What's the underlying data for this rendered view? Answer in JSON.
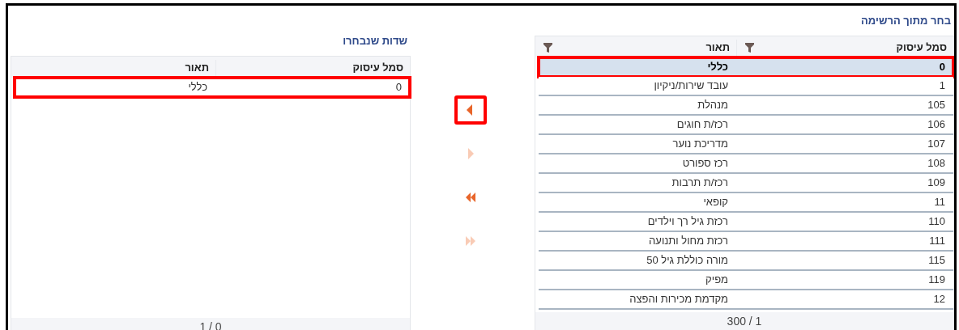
{
  "available": {
    "title": "בחר מתוך הרשימה",
    "columns": [
      {
        "label": "סמל עיסוק",
        "filter": true
      },
      {
        "label": "תאור",
        "filter": true
      }
    ],
    "rows": [
      {
        "code": "0",
        "description": "כללי",
        "selected": true,
        "highlighted": true
      },
      {
        "code": "1",
        "description": "עובד שירות/ניקיון",
        "selected": false,
        "highlighted": false
      },
      {
        "code": "105",
        "description": "מנהלת",
        "selected": false,
        "highlighted": false
      },
      {
        "code": "106",
        "description": "רכז/ת חוגים",
        "selected": false,
        "highlighted": false
      },
      {
        "code": "107",
        "description": "מדריכת נוער",
        "selected": false,
        "highlighted": false
      },
      {
        "code": "108",
        "description": "רכז ספורט",
        "selected": false,
        "highlighted": false
      },
      {
        "code": "109",
        "description": "רכז/ת תרבות",
        "selected": false,
        "highlighted": false
      },
      {
        "code": "11",
        "description": "קופאי",
        "selected": false,
        "highlighted": false
      },
      {
        "code": "110",
        "description": "רכזת גיל רך וילדים",
        "selected": false,
        "highlighted": false
      },
      {
        "code": "111",
        "description": "רכזת מחול ותנועה",
        "selected": false,
        "highlighted": false
      },
      {
        "code": "115",
        "description": "מורה כוללת גיל 50",
        "selected": false,
        "highlighted": false
      },
      {
        "code": "119",
        "description": "מפיק",
        "selected": false,
        "highlighted": false
      },
      {
        "code": "12",
        "description": "מקדמת מכירות והפצה",
        "selected": false,
        "highlighted": false
      }
    ],
    "footer": "300 / 1"
  },
  "buttons": [
    {
      "kind": "move-left",
      "disabled": false,
      "highlighted": true
    },
    {
      "kind": "move-right",
      "disabled": true,
      "highlighted": false
    },
    {
      "kind": "move-all-left",
      "disabled": false,
      "highlighted": false
    },
    {
      "kind": "move-all-right",
      "disabled": true,
      "highlighted": false
    }
  ],
  "chosen": {
    "title": "שדות שנבחרו",
    "columns": [
      {
        "label": "סמל עיסוק",
        "filter": false
      },
      {
        "label": "תאור",
        "filter": false
      }
    ],
    "rows": [
      {
        "code": "0",
        "description": "כללי",
        "selected": false,
        "highlighted": true
      }
    ],
    "footer": "1 / 0"
  }
}
